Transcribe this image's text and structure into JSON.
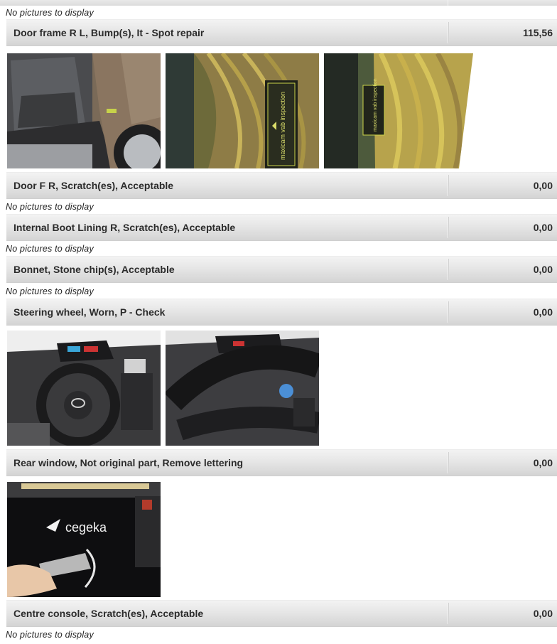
{
  "no_pictures_text": "No pictures to display",
  "items": [
    {
      "label": "Door frame R L, Bump(s), It - Spot repair",
      "value": "115,56",
      "photos": [
        "door-interior-photo",
        "door-frame-gauge-photo",
        "door-edge-gauge-photo"
      ]
    },
    {
      "label": "Door F R, Scratch(es), Acceptable",
      "value": "0,00",
      "photos": []
    },
    {
      "label": "Internal Boot Lining R, Scratch(es), Acceptable",
      "value": "0,00",
      "photos": []
    },
    {
      "label": "Bonnet, Stone chip(s), Acceptable",
      "value": "0,00",
      "photos": []
    },
    {
      "label": "Steering wheel, Worn, P - Check",
      "value": "0,00",
      "photos": [
        "dashboard-photo",
        "steering-wheel-closeup-photo"
      ]
    },
    {
      "label": "Rear window, Not original part, Remove lettering",
      "value": "0,00",
      "photos": [
        "rear-window-lettering-photo"
      ]
    },
    {
      "label": "Centre console, Scratch(es), Acceptable",
      "value": "0,00",
      "photos": []
    }
  ],
  "photo_texts": {
    "gauge_text_1": "maxicam vab inspection",
    "gauge_text_2": "maxicam vab inspection",
    "cegeka_logo": "cegeka"
  }
}
